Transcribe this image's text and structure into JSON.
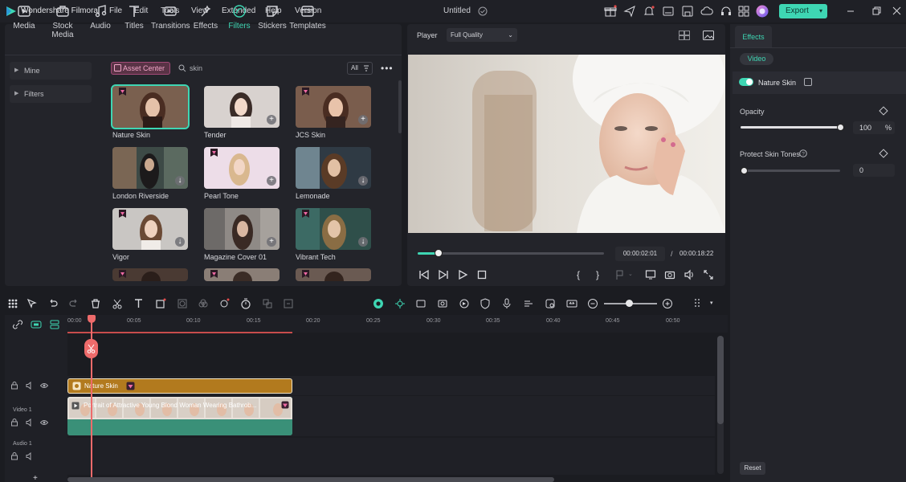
{
  "app": {
    "name": "Wondershare Filmora",
    "document_title": "Untitled",
    "export_label": "Export"
  },
  "menu": [
    "File",
    "Edit",
    "Tools",
    "View",
    "Extended",
    "Help",
    "Version"
  ],
  "media_tabs": [
    {
      "label": "Media",
      "icon": "media-icon"
    },
    {
      "label": "Stock Media",
      "icon": "stock-media-icon"
    },
    {
      "label": "Audio",
      "icon": "audio-icon"
    },
    {
      "label": "Titles",
      "icon": "titles-icon"
    },
    {
      "label": "Transitions",
      "icon": "transitions-icon"
    },
    {
      "label": "Effects",
      "icon": "effects-icon"
    },
    {
      "label": "Filters",
      "icon": "filters-icon",
      "active": true
    },
    {
      "label": "Stickers",
      "icon": "stickers-icon"
    },
    {
      "label": "Templates",
      "icon": "templates-icon"
    }
  ],
  "sidebar": {
    "items": [
      {
        "label": "Mine"
      },
      {
        "label": "Filters"
      }
    ]
  },
  "browser": {
    "asset_center_label": "Asset Center",
    "search_text": "skin",
    "filter_label": "All"
  },
  "filters": [
    {
      "name": "Nature Skin",
      "premium": true,
      "selected": true
    },
    {
      "name": "Tender",
      "premium": false,
      "action": "add"
    },
    {
      "name": "JCS Skin",
      "premium": true,
      "action": "add"
    },
    {
      "name": "London Riverside",
      "premium": false,
      "action": "download"
    },
    {
      "name": "Pearl Tone",
      "premium": true,
      "action": "add"
    },
    {
      "name": "Lemonade",
      "premium": false,
      "action": "download"
    },
    {
      "name": "Vigor",
      "premium": true,
      "action": "download"
    },
    {
      "name": "Magazine Cover 01",
      "premium": false,
      "action": "add"
    },
    {
      "name": "Vibrant Tech",
      "premium": true,
      "action": "download"
    }
  ],
  "player": {
    "label": "Player",
    "quality": "Full Quality",
    "current_time": "00:00:02:01",
    "total_time": "00:00:18:22",
    "time_separator": "/",
    "progress": 0.11
  },
  "effects_panel": {
    "tab": "Effects",
    "video_pill": "Video",
    "effect_name": "Nature Skin",
    "enabled": true,
    "opacity_label": "Opacity",
    "opacity_value": "100",
    "opacity_unit": "%",
    "opacity_fraction": 1.0,
    "protect_label": "Protect Skin Tones",
    "protect_value": "0",
    "protect_fraction": 0.0,
    "reset_label": "Reset"
  },
  "timeline": {
    "ruler_ticks": [
      "00:00",
      "00:05",
      "00:10",
      "00:15",
      "00:20",
      "00:25",
      "00:30",
      "00:35",
      "00:40",
      "00:45",
      "00:50"
    ],
    "tracks": {
      "video_label": "Video 1",
      "audio_label": "Audio 1"
    },
    "effect_clip_label": "Nature Skin",
    "video_clip_label": "Portrait of Attractive Young Blond Woman Wearing Bathrob..."
  },
  "colors": {
    "accent": "#3ed6b3",
    "premium": "#f06aa5",
    "playhead": "#ee6b6b",
    "effect_clip": "#b27a1e",
    "video_clip": "#3a9078"
  }
}
